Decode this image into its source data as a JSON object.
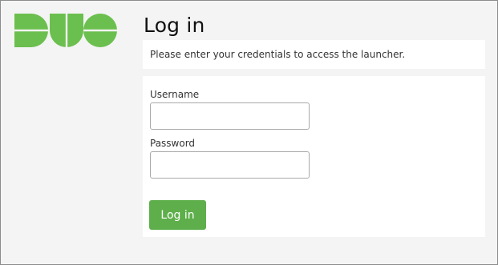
{
  "brand": {
    "logo_text": "DUO",
    "color": "#6bbf4e"
  },
  "page": {
    "title": "Log in",
    "message": "Please enter your credentials to access the launcher."
  },
  "form": {
    "username_label": "Username",
    "username_value": "",
    "password_label": "Password",
    "password_value": "",
    "submit_label": "Log in",
    "submit_color": "#5eaf4b"
  }
}
